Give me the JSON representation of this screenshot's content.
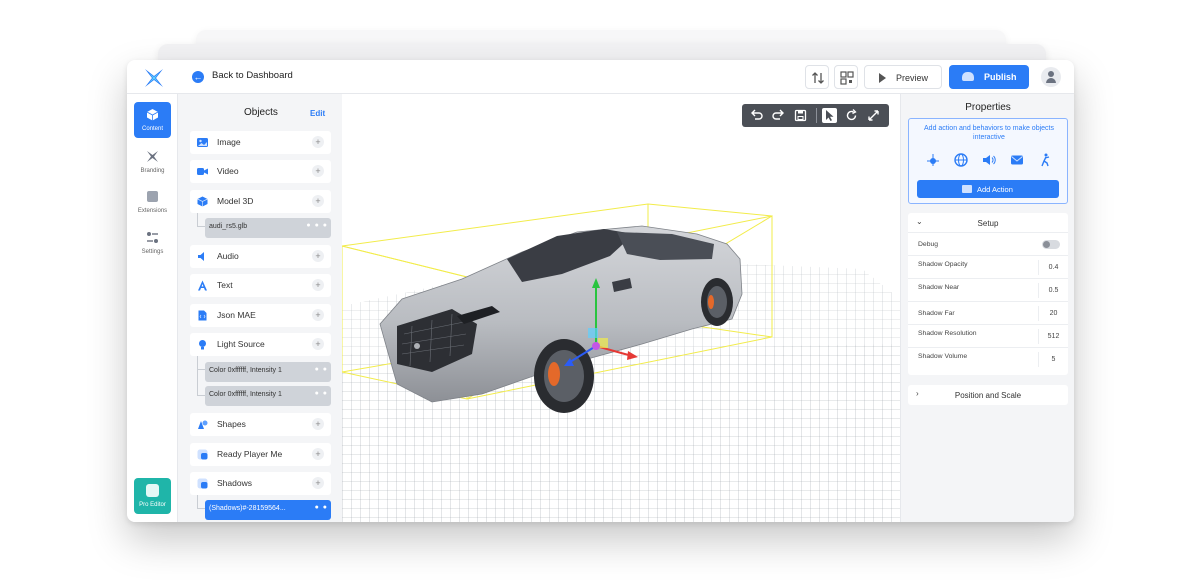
{
  "topbar": {
    "back_label": "Back to Dashboard",
    "preview_label": "Preview",
    "publish_label": "Publish"
  },
  "rail": {
    "items": [
      {
        "label": "Content",
        "icon": "cube-icon",
        "active": true
      },
      {
        "label": "Branding",
        "icon": "star-icon",
        "active": false
      },
      {
        "label": "Extensions",
        "icon": "puzzle-icon",
        "active": false
      },
      {
        "label": "Settings",
        "icon": "sliders-icon",
        "active": false
      }
    ],
    "pro_editor_label": "Pro Editor"
  },
  "objects": {
    "title": "Objects",
    "edit_label": "Edit",
    "items": [
      {
        "label": "Image",
        "icon": "image-icon"
      },
      {
        "label": "Video",
        "icon": "video-icon"
      },
      {
        "label": "Model 3D",
        "icon": "cube-icon"
      },
      {
        "label": "Audio",
        "icon": "speaker-icon"
      },
      {
        "label": "Text",
        "icon": "text-icon"
      },
      {
        "label": "Json MAE",
        "icon": "code-file-icon"
      },
      {
        "label": "Light Source",
        "icon": "bulb-icon"
      },
      {
        "label": "Shapes",
        "icon": "shapes-icon"
      },
      {
        "label": "Ready Player Me",
        "icon": "avatar-icon"
      },
      {
        "label": "Shadows",
        "icon": "shadow-icon"
      }
    ],
    "children": {
      "model": "audi_rs5.glb",
      "light_1": "Color 0xffffff, Intensity 1",
      "light_2": "Color 0xffffff, Intensity 1",
      "shadows": "(Shadows)#-28159564..."
    }
  },
  "properties": {
    "title": "Properties",
    "action_text": "Add action and behaviors to make objects interactive",
    "add_action_label": "Add Action",
    "setup_label": "Setup",
    "rows": [
      {
        "key": "Debug",
        "value": ""
      },
      {
        "key": "Shadow Opacity",
        "value": "0.4"
      },
      {
        "key": "Shadow Near",
        "value": "0.5"
      },
      {
        "key": "Shadow Far",
        "value": "20"
      },
      {
        "key": "Shadow Resolution",
        "value": "512"
      },
      {
        "key": "Shadow Volume",
        "value": "5"
      }
    ],
    "debug_enabled": false,
    "position_scale_label": "Position and Scale"
  },
  "colors": {
    "accent": "#2b7cf6",
    "pro_editor": "#1fb5a9",
    "bounding_box": "#f2ec4a"
  }
}
